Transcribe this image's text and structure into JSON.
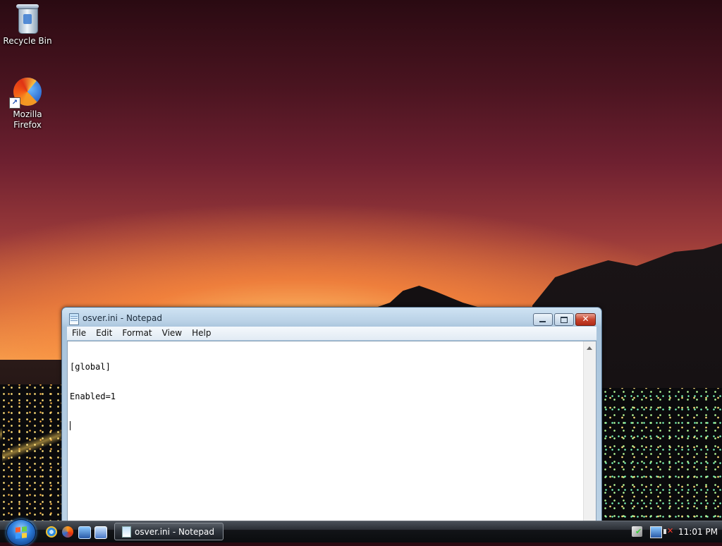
{
  "desktop": {
    "icons": [
      {
        "label": "Recycle Bin",
        "icon": "recycle-bin-icon"
      },
      {
        "label": "Mozilla Firefox",
        "icon": "firefox-icon"
      }
    ]
  },
  "notepad": {
    "title": "osver.ini - Notepad",
    "menu": [
      "File",
      "Edit",
      "Format",
      "View",
      "Help"
    ],
    "content_lines": [
      "[global]",
      "Enabled=1",
      ""
    ],
    "caption_close_glyph": "✕"
  },
  "taskbar": {
    "quick_launch": [
      "internet-explorer-icon",
      "firefox-icon",
      "show-desktop-icon",
      "switch-windows-icon"
    ],
    "active_task": "osver.ini - Notepad",
    "tray_icons": [
      "windows-security-icon",
      "network-icon",
      "volume-muted-icon"
    ],
    "clock": "11:01 PM"
  },
  "colors": {
    "close_button": "#c8452e",
    "taskbar": "#121418"
  }
}
